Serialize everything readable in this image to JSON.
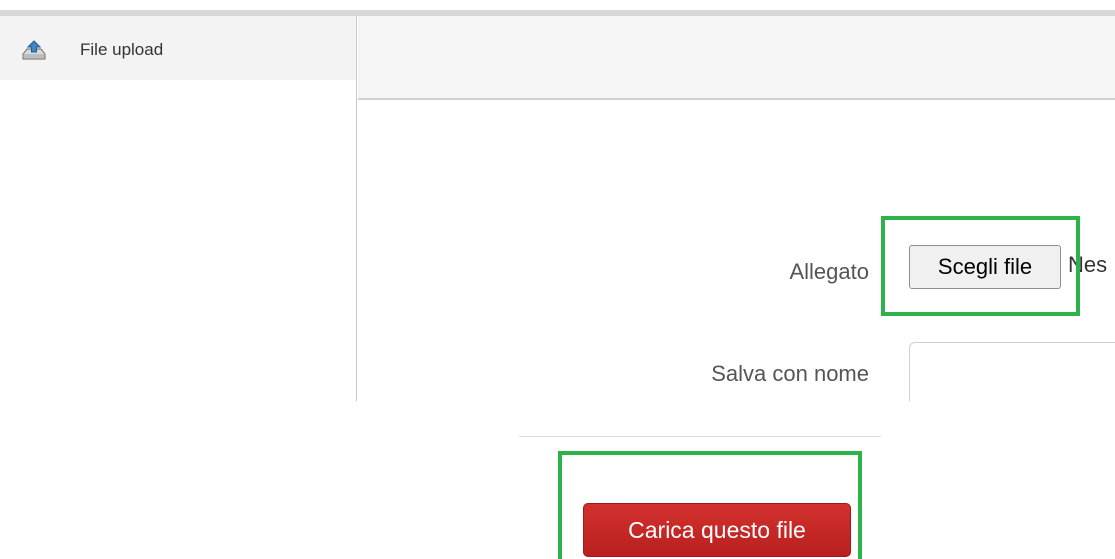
{
  "sidebar": {
    "items": [
      {
        "label": "File upload",
        "icon": "upload-tray-icon"
      }
    ]
  },
  "form": {
    "attachment_label": "Allegato",
    "choose_file_label": "Scegli file",
    "file_status_text": "Nes",
    "save_as_label": "Salva con nome",
    "save_as_value": "",
    "submit_label": "Carica questo file"
  },
  "colors": {
    "highlight": "#2db34a",
    "submit_bg": "#c0272a",
    "sidebar_active_bg": "#f3f3f3"
  }
}
